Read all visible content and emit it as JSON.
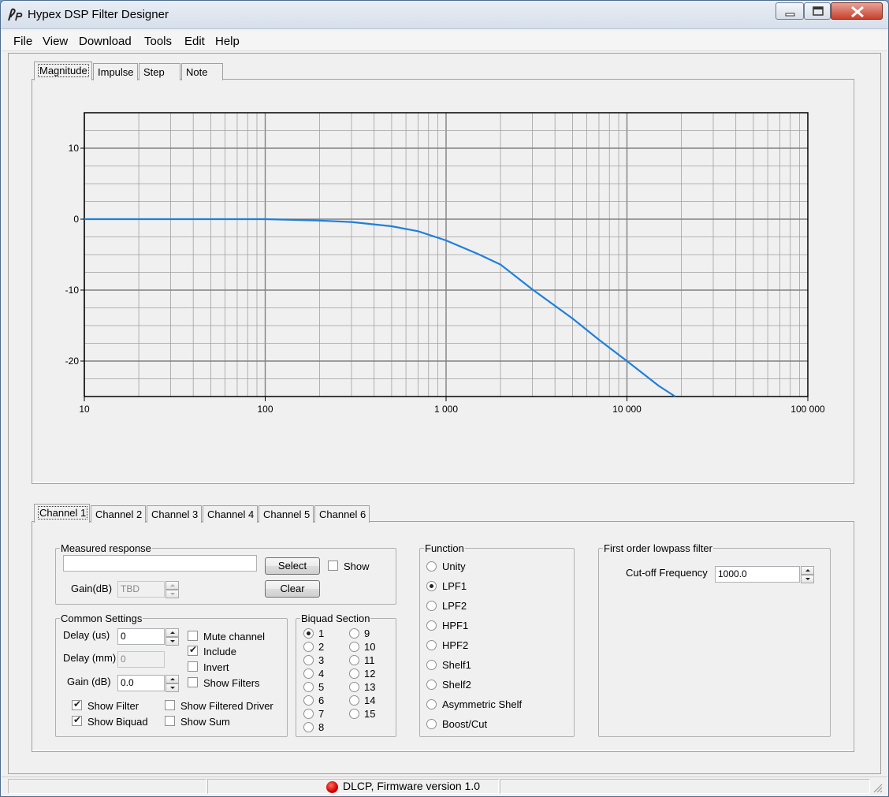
{
  "window": {
    "title": "Hypex DSP Filter Designer"
  },
  "menu": [
    "File",
    "View",
    "Download",
    "Tools",
    "Edit",
    "Help"
  ],
  "plot_tabs": [
    "Magnitude",
    "Impulse",
    "Step",
    "Note"
  ],
  "plot_tabs_active": "Magnitude",
  "chart_data": {
    "type": "line",
    "x_scale": "log",
    "xlim": [
      10,
      100000
    ],
    "ylim": [
      -25,
      15
    ],
    "x_ticks": [
      {
        "value": 10,
        "label": "10"
      },
      {
        "value": 100,
        "label": "100"
      },
      {
        "value": 1000,
        "label": "1 000"
      },
      {
        "value": 10000,
        "label": "10 000"
      },
      {
        "value": 100000,
        "label": "100 000"
      }
    ],
    "y_ticks": [
      {
        "value": 10,
        "label": "10"
      },
      {
        "value": 0,
        "label": "0"
      },
      {
        "value": -10,
        "label": "-10"
      },
      {
        "value": -20,
        "label": "-20"
      }
    ],
    "grid": true,
    "series": [
      {
        "color": "#1e7fdc",
        "x": [
          10,
          20,
          40,
          100,
          200,
          300,
          500,
          700,
          1000,
          1500,
          2000,
          3000,
          5000,
          7000,
          10000,
          15000,
          18500
        ],
        "y": [
          0,
          0,
          0,
          0,
          -0.2,
          -0.4,
          -1.0,
          -1.7,
          -3.0,
          -4.9,
          -6.4,
          -9.9,
          -14.0,
          -17.0,
          -20.0,
          -23.5,
          -25.0
        ]
      }
    ]
  },
  "channel_tabs": [
    "Channel 1",
    "Channel 2",
    "Channel 3",
    "Channel 4",
    "Channel 5",
    "Channel 6"
  ],
  "channel_tabs_active": "Channel 1",
  "measured": {
    "legend": "Measured response",
    "path_value": "",
    "select_label": "Select",
    "show_label": "Show",
    "show_checked": false,
    "gain_label": "Gain(dB)",
    "gain_value": "TBD",
    "clear_label": "Clear"
  },
  "common": {
    "legend": "Common Settings",
    "delay_us_label": "Delay (us)",
    "delay_us_value": "0",
    "delay_mm_label": "Delay (mm)",
    "delay_mm_value": "0",
    "gain_label": "Gain (dB)",
    "gain_value": "0.0",
    "mute_label": "Mute channel",
    "include_label": "Include",
    "invert_label": "Invert",
    "show_filters_label": "Show Filters",
    "show_filter_label": "Show Filter",
    "show_filtered_driver_label": "Show Filtered Driver",
    "show_biquad_label": "Show Biquad",
    "show_sum_label": "Show Sum",
    "states": {
      "mute": false,
      "include": true,
      "invert": false,
      "show_filters": false,
      "show_filter": true,
      "show_filtered_driver": false,
      "show_biquad": true,
      "show_sum": false
    }
  },
  "biquad": {
    "legend": "Biquad Section",
    "left": [
      "1",
      "2",
      "3",
      "4",
      "5",
      "6",
      "7",
      "8"
    ],
    "right": [
      "9",
      "10",
      "11",
      "12",
      "13",
      "14",
      "15"
    ],
    "selected": "1"
  },
  "function": {
    "legend": "Function",
    "options": [
      "Unity",
      "LPF1",
      "LPF2",
      "HPF1",
      "HPF2",
      "Shelf1",
      "Shelf2",
      "Asymmetric Shelf",
      "Boost/Cut"
    ],
    "selected": "LPF1"
  },
  "filter_params": {
    "legend": "First order lowpass filter",
    "cutoff_label": "Cut-off Frequency",
    "cutoff_value": "1000.0"
  },
  "status": {
    "text": "DLCP, Firmware version 1.0",
    "indicator_color": "#d20000"
  }
}
